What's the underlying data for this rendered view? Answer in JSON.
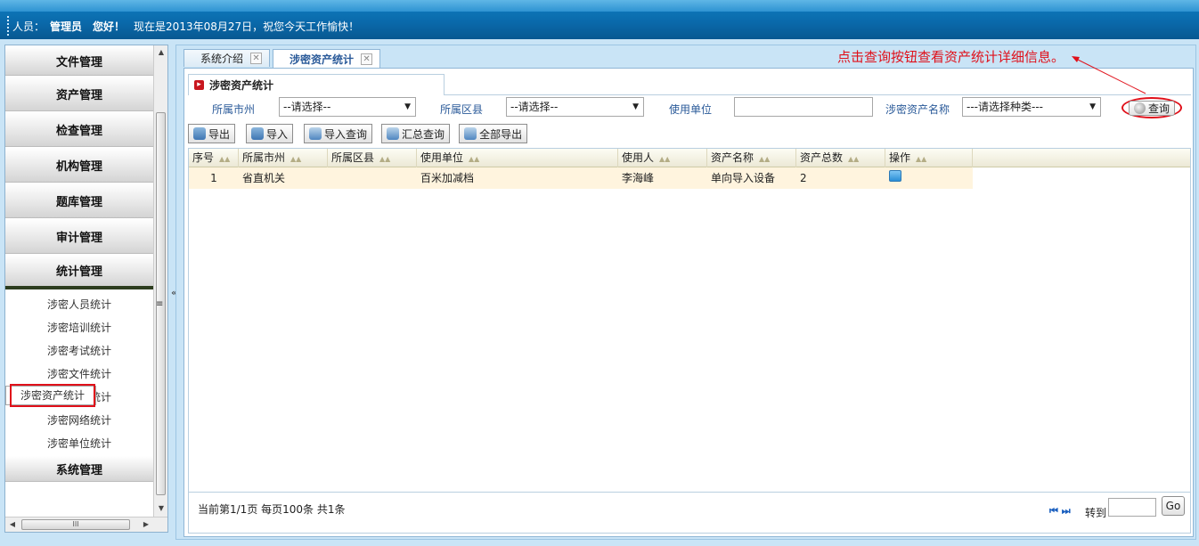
{
  "header": {
    "user_label": "人员：",
    "user_name": "管理员",
    "greeting": "您好！",
    "date_text": "现在是2013年08月27日，祝您今天工作愉快！"
  },
  "sidebar": {
    "menus": [
      {
        "label": "文件管理"
      },
      {
        "label": "资产管理"
      },
      {
        "label": "检查管理"
      },
      {
        "label": "机构管理"
      },
      {
        "label": "题库管理"
      },
      {
        "label": "审计管理"
      },
      {
        "label": "统计管理"
      }
    ],
    "sub_items": [
      {
        "label": "涉密人员统计"
      },
      {
        "label": "涉密培训统计"
      },
      {
        "label": "涉密考试统计"
      },
      {
        "label": "涉密文件统计"
      },
      {
        "label": "涉密资产统计"
      },
      {
        "label": "涉密终端统计"
      },
      {
        "label": "涉密网络统计"
      },
      {
        "label": "涉密单位统计"
      }
    ],
    "last_menu": "系统管理",
    "scroll_grip": "III",
    "collapse_glyph": "«",
    "menu_glyph": "≡"
  },
  "tabs": [
    {
      "label": "系统介绍",
      "close": "✕"
    },
    {
      "label": "涉密资产统计",
      "close": "✕"
    }
  ],
  "annotation": "点击查询按钮查看资产统计详细信息。",
  "panel_title": "涉密资产统计",
  "filters": {
    "city_label": "所属市州",
    "city_value": "--请选择--",
    "county_label": "所属区县",
    "county_value": "--请选择--",
    "unit_label": "使用单位",
    "unit_value": "",
    "asset_label": "涉密资产名称",
    "asset_value": "---请选择种类---"
  },
  "query_button": "查询",
  "toolbar": {
    "export": "导出",
    "import": "导入",
    "import_query": "导入查询",
    "summary_query": "汇总查询",
    "export_all": "全部导出"
  },
  "table": {
    "columns": [
      "序号",
      "所属市州",
      "所属区县",
      "使用单位",
      "使用人",
      "资产名称",
      "资产总数",
      "操作"
    ],
    "rows": [
      {
        "no": "1",
        "city": "省直机关",
        "county": "",
        "unit": "百米加减档",
        "user": "李海峰",
        "asset": "单向导入设备",
        "total": "2"
      }
    ]
  },
  "pager": {
    "info": "当前第1/1页  每页100条  共1条",
    "nav": "⏮ ⏭",
    "goto_label": "转到",
    "go_label": "Go"
  },
  "colors": {
    "annotation_red": "#e0101a",
    "header_blue": "#0a68a9"
  }
}
